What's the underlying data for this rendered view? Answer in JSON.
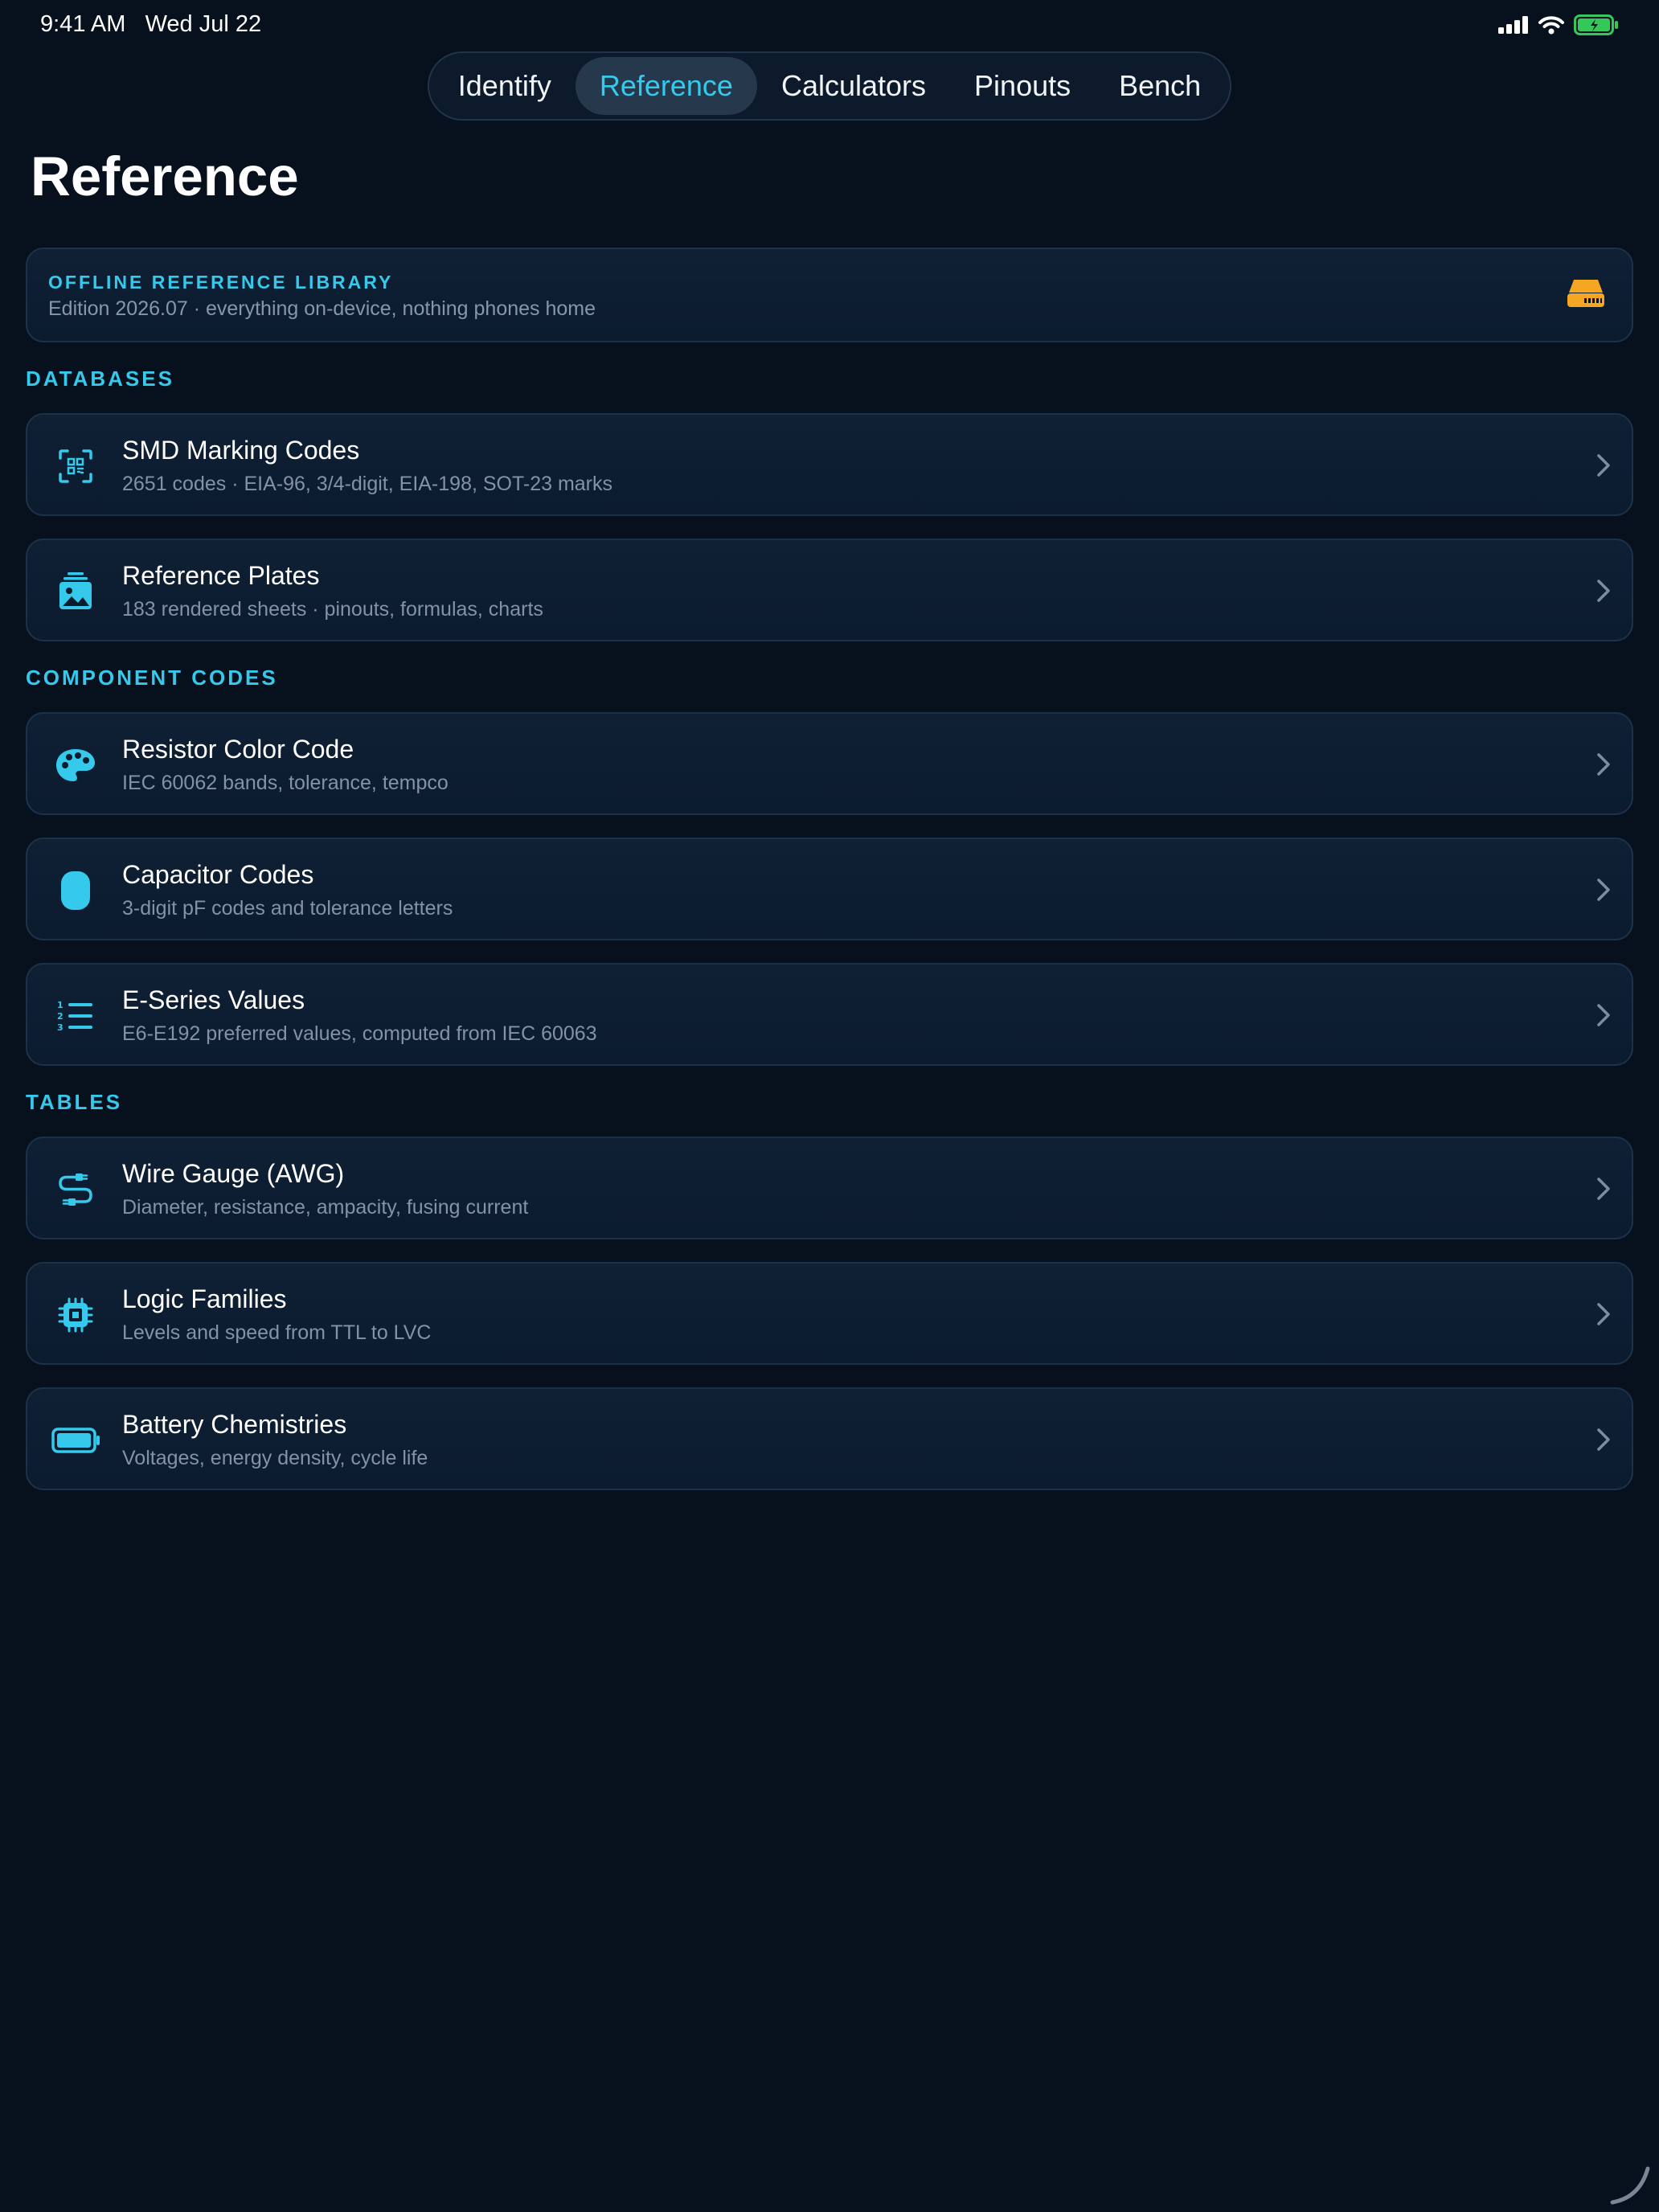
{
  "status": {
    "time": "9:41 AM",
    "date": "Wed Jul 22",
    "battery_color": "#34c759"
  },
  "tabs": [
    {
      "label": "Identify",
      "active": false
    },
    {
      "label": "Reference",
      "active": true
    },
    {
      "label": "Calculators",
      "active": false
    },
    {
      "label": "Pinouts",
      "active": false
    },
    {
      "label": "Bench",
      "active": false
    }
  ],
  "page": {
    "title": "Reference"
  },
  "banner": {
    "title": "OFFLINE REFERENCE LIBRARY",
    "subtitle": "Edition 2026.07 · everything on-device, nothing phones home",
    "icon": "storage-drive-icon",
    "icon_color": "#f5a623"
  },
  "accent_color": "#35c9ec",
  "sections": {
    "databases": {
      "label": "DATABASES",
      "items": [
        {
          "title": "SMD Marking Codes",
          "subtitle": "2651 codes · EIA-96, 3/4-digit, EIA-198, SOT-23 marks",
          "icon": "qr-scan-icon"
        },
        {
          "title": "Reference Plates",
          "subtitle": "183 rendered sheets · pinouts, formulas, charts",
          "icon": "photo-stack-icon"
        }
      ]
    },
    "component_codes": {
      "label": "COMPONENT CODES",
      "items": [
        {
          "title": "Resistor Color Code",
          "subtitle": "IEC 60062 bands, tolerance, tempco",
          "icon": "palette-icon"
        },
        {
          "title": "Capacitor Codes",
          "subtitle": "3-digit pF codes and tolerance letters",
          "icon": "capsule-icon"
        },
        {
          "title": "E-Series Values",
          "subtitle": "E6-E192 preferred values, computed from IEC 60063",
          "icon": "numbered-list-icon"
        }
      ]
    },
    "tables": {
      "label": "TABLES",
      "items": [
        {
          "title": "Wire Gauge (AWG)",
          "subtitle": "Diameter, resistance, ampacity, fusing current",
          "icon": "cable-connector-icon"
        },
        {
          "title": "Logic Families",
          "subtitle": "Levels and speed from TTL to LVC",
          "icon": "cpu-chip-icon"
        },
        {
          "title": "Battery Chemistries",
          "subtitle": "Voltages, energy density, cycle life",
          "icon": "battery-icon"
        }
      ]
    }
  }
}
